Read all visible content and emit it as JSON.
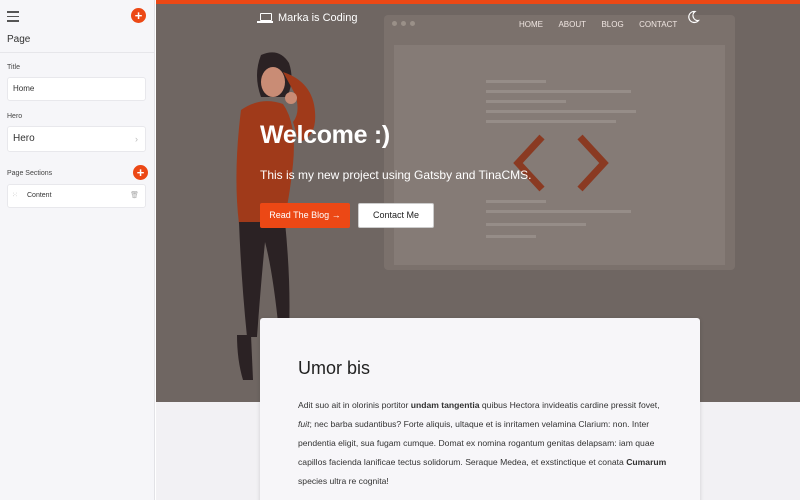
{
  "sidebar": {
    "page_title": "Page",
    "title_label": "Title",
    "title_value": "Home",
    "hero_label": "Hero",
    "hero_value": "Hero",
    "sections_label": "Page Sections",
    "section_items": [
      "Content"
    ]
  },
  "site": {
    "brand": "Marka is Coding",
    "nav": [
      "HOME",
      "ABOUT",
      "BLOG",
      "CONTACT"
    ],
    "hero": {
      "title": "Welcome :)",
      "subtitle": "This is my new project using Gatsby and TinaCMS.",
      "primary_button": "Read The Blog →",
      "secondary_button": "Contact Me"
    },
    "card": {
      "title": "Umor bis",
      "p1": "Adit suo ait in olorinis portitor ",
      "p1_bold": "undam tangentia",
      "p2": " quibus Hectora invideatis cardine pressit fovet, ",
      "p2_italic": "fuit",
      "p3": "; nec barba sudantibus? Forte aliquis, ultaque et is inritamen velamina Clarium: non. Inter pendentia eligit, sua fugam cumque. Domat ex nomina rogantum genitas delapsam: iam quae capillos facienda lanificae tectus solidorum. Seraque Medea, et exstinctique et conata ",
      "p3_bold": "Cumarum",
      "p4": " species ultra re cognita!"
    }
  },
  "colors": {
    "accent": "#ec4815",
    "hero_bg": "#6f6662",
    "sidebar_bg": "#f6f6f9"
  },
  "icons": {
    "menu": "hamburger-icon",
    "add": "plus-icon",
    "logo": "laptop-icon",
    "theme": "moon-icon",
    "drag": "drag-handle-icon",
    "delete": "trash-icon",
    "chevron": "chevron-right-icon"
  }
}
